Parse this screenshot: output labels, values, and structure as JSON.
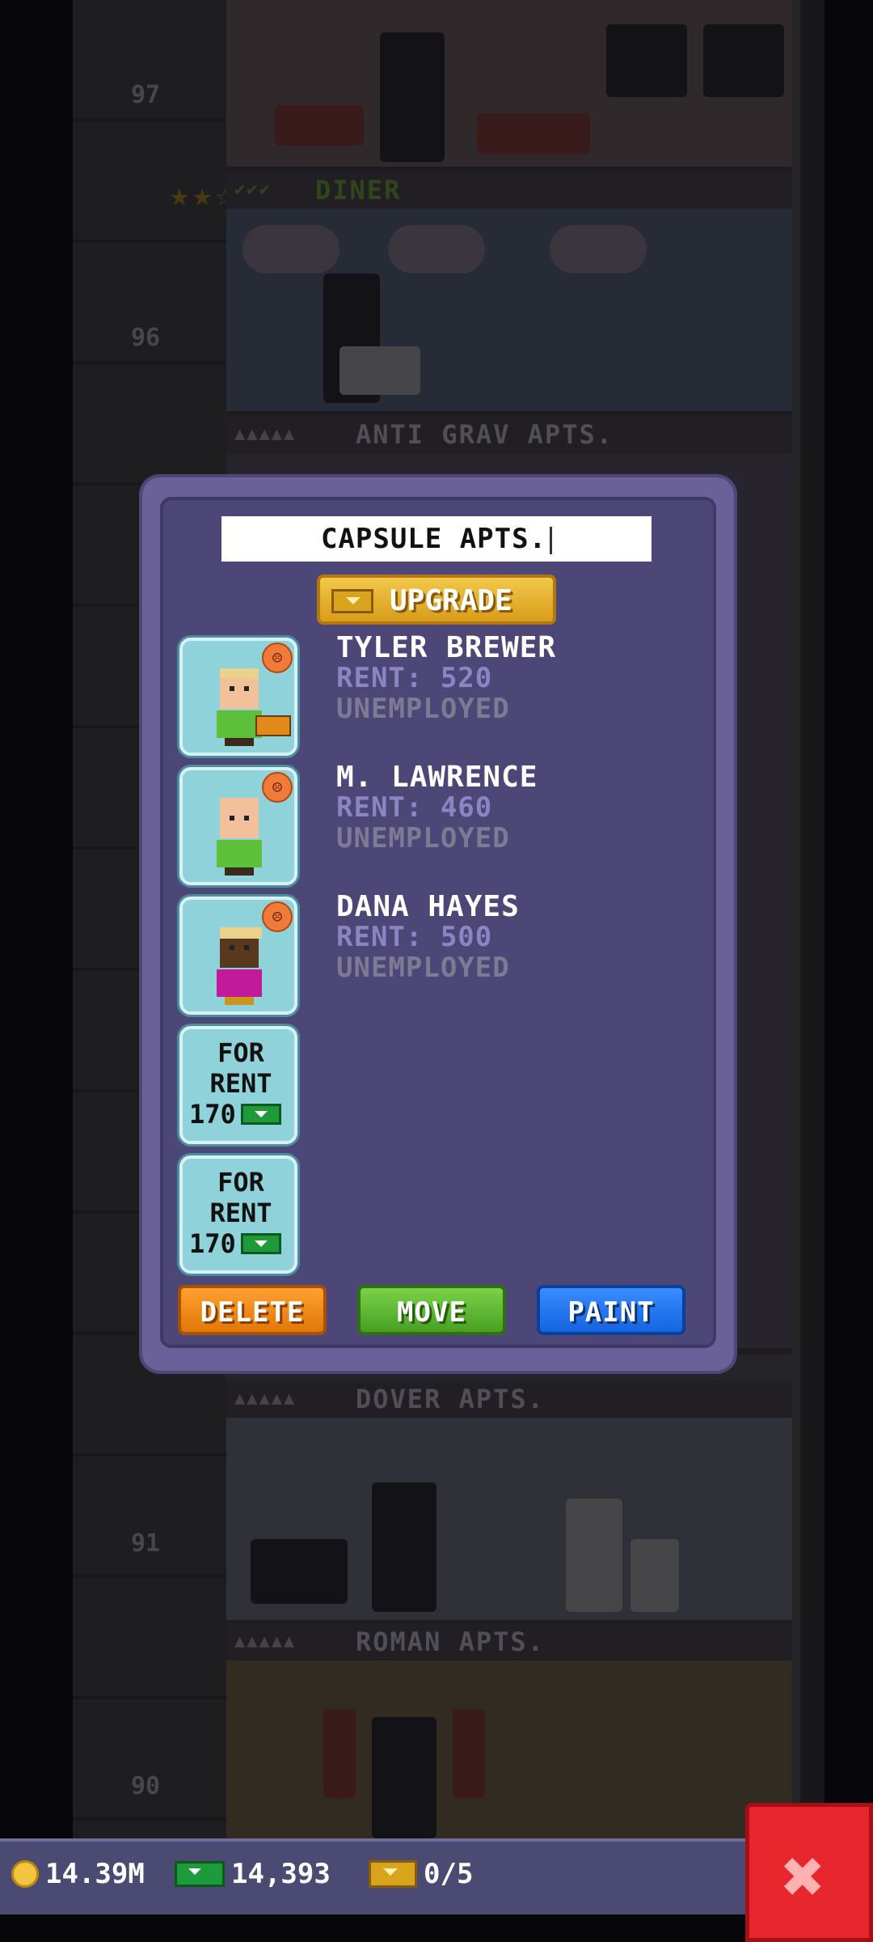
{
  "background": {
    "floor_numbers": [
      "97",
      "96",
      "91",
      "90"
    ],
    "floors": [
      {
        "name": "DINER"
      },
      {
        "name": "ANTI GRAV APTS."
      },
      {
        "name": "DOVER APTS."
      },
      {
        "name": "ROMAN APTS."
      }
    ]
  },
  "panel": {
    "floor_name": "CAPSULE APTS.",
    "upgrade_label": "UPGRADE",
    "tenants": [
      {
        "name": "TYLER BREWER",
        "rent": "RENT: 520",
        "job": "UNEMPLOYED",
        "mood": "unhappy"
      },
      {
        "name": "M. LAWRENCE",
        "rent": "RENT: 460",
        "job": "UNEMPLOYED",
        "mood": "unhappy"
      },
      {
        "name": "DANA HAYES",
        "rent": "RENT: 500",
        "job": "UNEMPLOYED",
        "mood": "unhappy"
      }
    ],
    "vacancies": [
      {
        "line1": "FOR",
        "line2": "RENT",
        "price": "170"
      },
      {
        "line1": "FOR",
        "line2": "RENT",
        "price": "170"
      }
    ],
    "buttons": {
      "delete": "DELETE",
      "move": "MOVE",
      "paint": "PAINT"
    }
  },
  "status_bar": {
    "coins": "14.39M",
    "bux_cash": "14,393",
    "golden_bux": "0/5"
  },
  "colors": {
    "panel": "#6a6198",
    "delete": "#f08a18",
    "move": "#5cb832",
    "paint": "#2878f0",
    "close": "#e8262e"
  }
}
